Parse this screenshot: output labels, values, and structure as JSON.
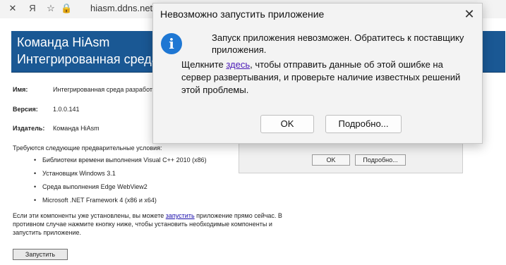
{
  "browser": {
    "url": "hiasm.ddns.net"
  },
  "page": {
    "banner_title1": "Команда HiAsm",
    "banner_title2": "Интегрированная среда",
    "name_label": "Имя:",
    "name_value": "Интегрированная среда разработ",
    "version_label": "Версия:",
    "version_value": "1.0.0.141",
    "publisher_label": "Издатель:",
    "publisher_value": "Команда HiAsm",
    "prereq_heading": "Требуются следующие предварительные условия:",
    "prereqs": [
      "Библиотеки времени выполнения Visual C++ 2010 (x86)",
      "Установщик Windows 3.1",
      "Среда выполнения Edge WebView2",
      "Microsoft .NET Framework 4 (x86 и x64)"
    ],
    "note_before": "Если эти компоненты уже установлены, вы можете ",
    "note_link": "запустить",
    "note_after": " приложение прямо сейчас. В противном случае нажмите кнопку ниже, чтобы установить необходимые компоненты и запустить приложение.",
    "run_button": "Запустить"
  },
  "background_dialog": {
    "ok_button": "OK",
    "details_button": "Подробно..."
  },
  "dialog": {
    "title": "Невозможно запустить приложение",
    "message1": "Запуск приложения невозможен. Обратитесь к поставщику приложения.",
    "message2_before": "Щелкните ",
    "message2_link": "здесь",
    "message2_after": ", чтобы отправить данные об этой ошибке на сервер развертывания, и проверьте наличие известных решений этой проблемы.",
    "ok_button": "OK",
    "details_button": "Подробно...",
    "icon": "info-icon",
    "close_icon": "close-icon",
    "accent_color": "#1e77d3"
  }
}
